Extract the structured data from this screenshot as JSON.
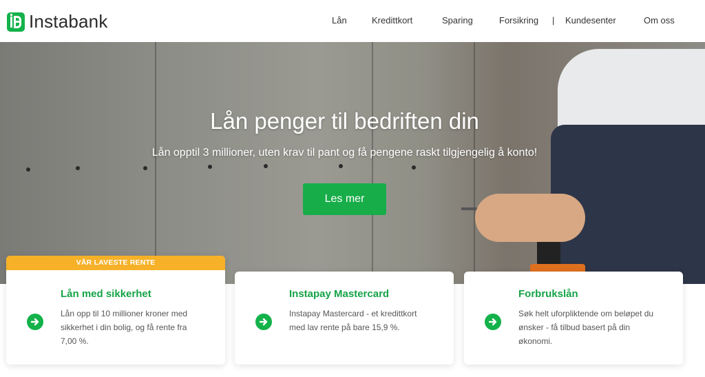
{
  "brand": {
    "name": "Instabank",
    "color": "#13b24a"
  },
  "nav": {
    "items": [
      "Lån",
      "Kredittkort",
      "Sparing",
      "Forsikring",
      "Kundesenter",
      "Om oss"
    ],
    "separator": "|"
  },
  "hero": {
    "title": "Lån penger til bedriften din",
    "subtitle": "Lån opptil 3 millioner, uten krav til pant og få pengene raskt tilgjengelig å konto!",
    "button_label": "Les mer"
  },
  "cards": [
    {
      "ribbon": "VÅR LAVESTE RENTE",
      "title": "Lån med sikkerhet",
      "description": "Lån opp til 10 millioner kroner med sikkerhet i din bolig, og få rente fra 7,00 %.",
      "icon": "arrow-right-circle-icon"
    },
    {
      "title": "Instapay Mastercard",
      "description": "Instapay Mastercard - et kredittkort med lav rente på bare 15,9 %.",
      "icon": "arrow-right-circle-icon"
    },
    {
      "title": "Forbrukslån",
      "description": "Søk helt uforpliktende om beløpet du ønsker - få tilbud basert på din økonomi.",
      "icon": "arrow-right-circle-icon"
    }
  ],
  "colors": {
    "accent": "#13b24a",
    "ribbon": "#f6b128"
  }
}
